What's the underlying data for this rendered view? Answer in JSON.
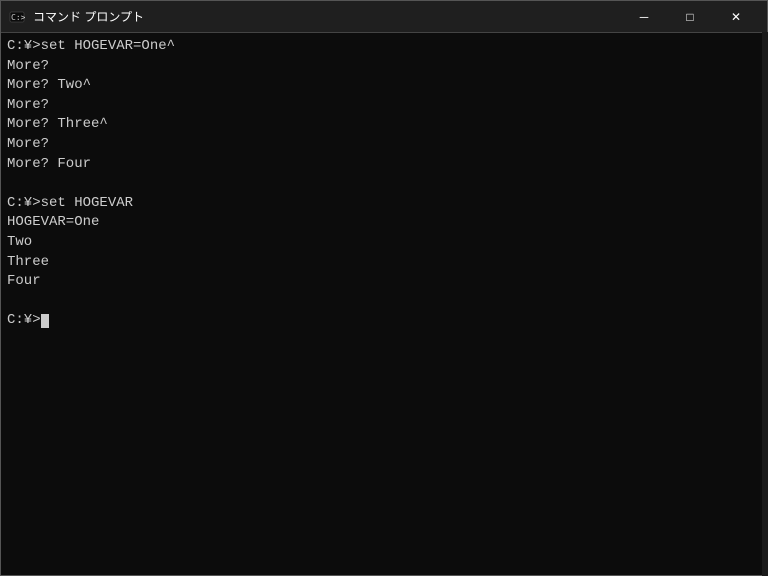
{
  "window": {
    "title": "コマンド プロンプト",
    "icon": "cmd-icon"
  },
  "titlebar": {
    "minimize_label": "─",
    "maximize_label": "□",
    "close_label": "✕"
  },
  "console": {
    "lines": [
      "C:\\¥>set HOGEVAR=One^",
      "More?",
      "More? Two^",
      "More?",
      "More? Three^",
      "More?",
      "More? Four",
      "",
      "C:\\¥>set HOGEVAR",
      "HOGEVAR=One",
      "Two",
      "Three",
      "Four",
      "",
      "C:\\¥>"
    ]
  }
}
